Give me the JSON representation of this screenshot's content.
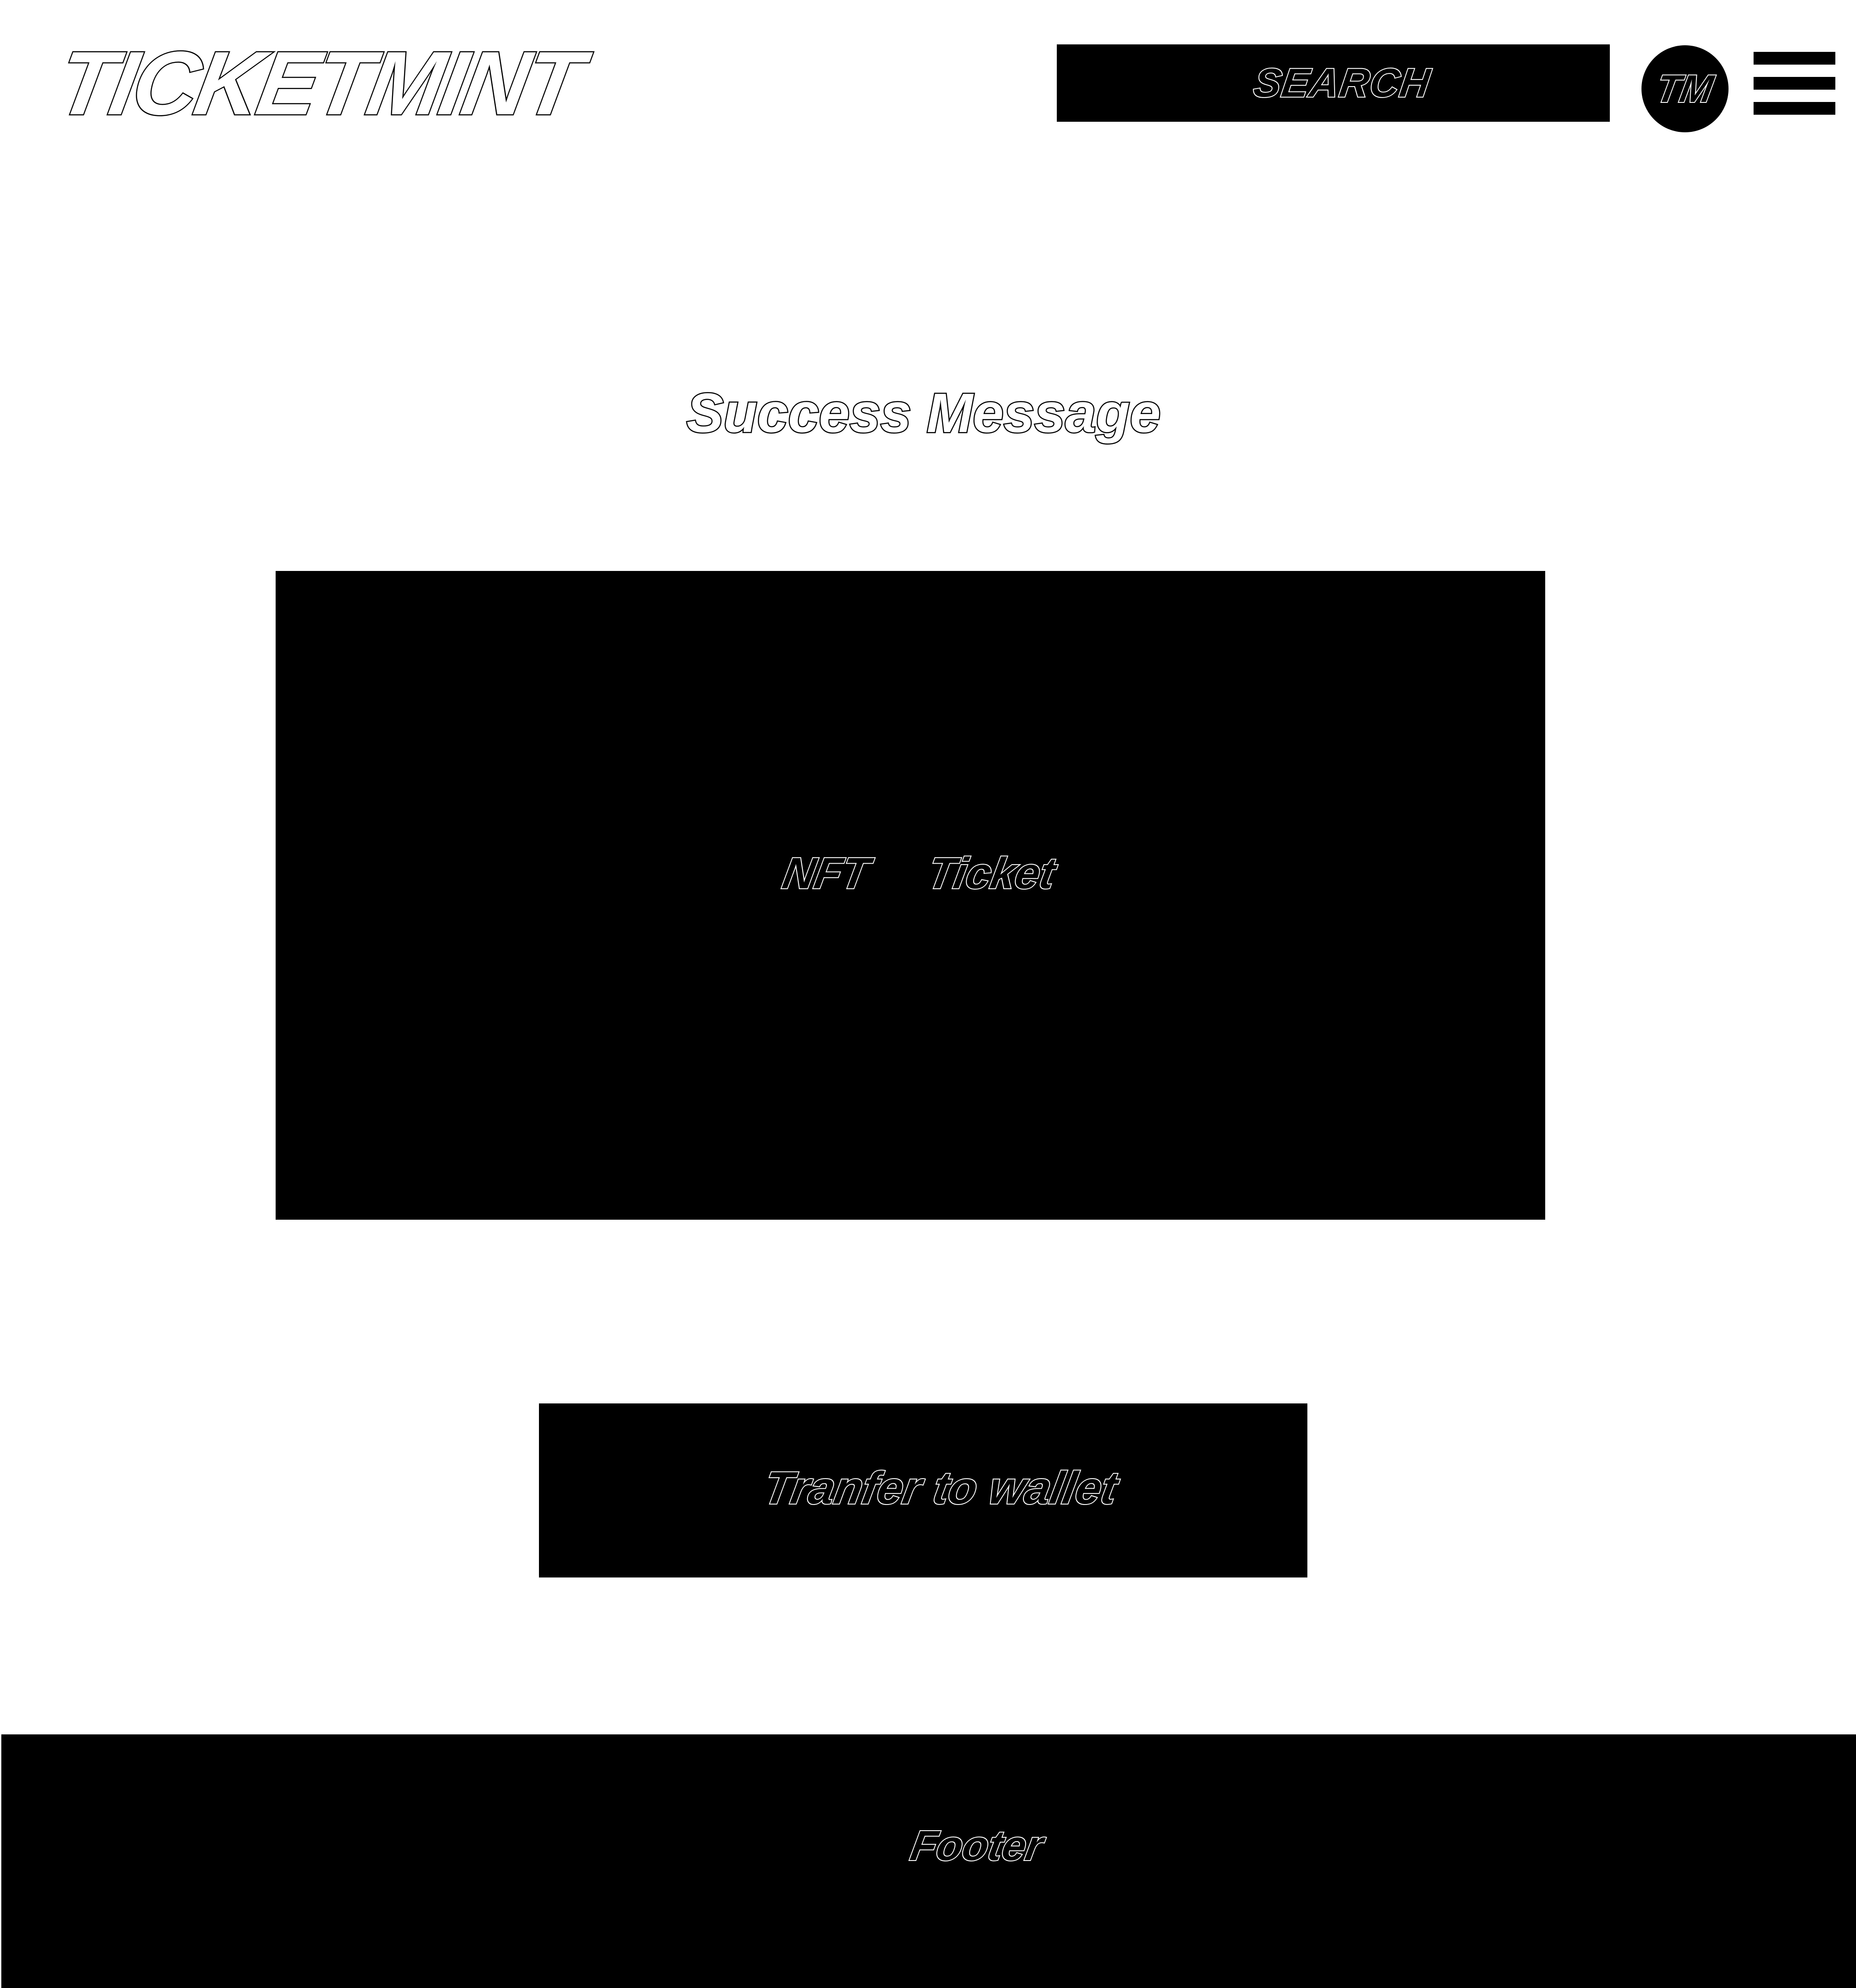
{
  "header": {
    "logo": "TICKETMINT",
    "search_label": "SEARCH",
    "avatar_initials": "TM"
  },
  "main": {
    "success_message": "Success Message",
    "nft_ticket_label": "NFT  Ticket",
    "transfer_button_label": "Tranfer to wallet"
  },
  "footer": {
    "label": "Footer"
  },
  "colors": {
    "background": "#ffffff",
    "block": "#000000"
  },
  "icons": {
    "menu": "hamburger-menu-icon"
  }
}
